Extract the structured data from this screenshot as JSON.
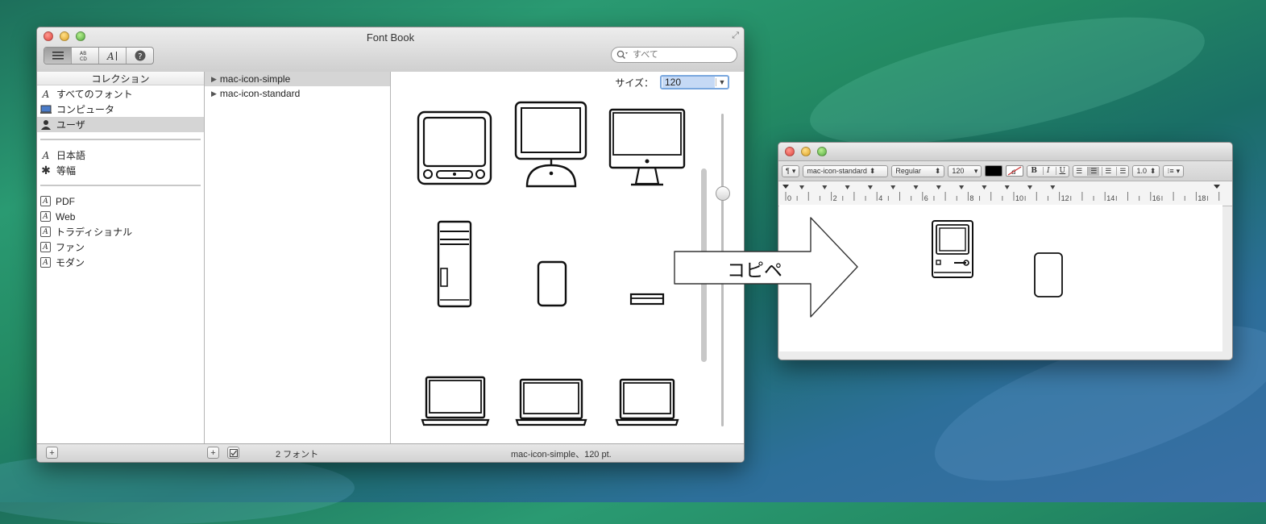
{
  "fontbook": {
    "title": "Font Book",
    "toolbar": {
      "view_buttons": [
        "list-view",
        "sample-view",
        "repertoire-view",
        "info-view"
      ],
      "search_placeholder": "すべて"
    },
    "collections": {
      "header": "コレクション",
      "group1": [
        {
          "label": "すべてのフォント",
          "icon": "font-icon"
        },
        {
          "label": "コンピュータ",
          "icon": "computer-icon"
        },
        {
          "label": "ユーザ",
          "icon": "user-icon",
          "selected": true
        }
      ],
      "group2": [
        {
          "label": "日本語",
          "icon": "font-icon"
        },
        {
          "label": "等幅",
          "icon": "gear-icon"
        }
      ],
      "group3": [
        {
          "label": "PDF",
          "icon": "collection-icon"
        },
        {
          "label": "Web",
          "icon": "collection-icon"
        },
        {
          "label": "トラディショナル",
          "icon": "collection-icon"
        },
        {
          "label": "ファン",
          "icon": "collection-icon"
        },
        {
          "label": "モダン",
          "icon": "collection-icon"
        }
      ]
    },
    "families": [
      {
        "label": "mac-icon-simple",
        "selected": true
      },
      {
        "label": "mac-icon-standard",
        "selected": false
      }
    ],
    "preview": {
      "size_label": "サイズ：",
      "size_value": "120"
    },
    "status": {
      "font_count": "2 フォント",
      "selection_info": "mac-icon-simple、120 pt."
    }
  },
  "overlay": {
    "arrow_label": "コピペ"
  },
  "textedit": {
    "toolbar": {
      "paragraph": "¶",
      "font_family": "mac-icon-standard",
      "font_style": "Regular",
      "font_size": "120",
      "bold": "B",
      "italic": "I",
      "underline": "U",
      "line_spacing": "1.0"
    },
    "ruler_labels": [
      "0",
      "2",
      "4",
      "6",
      "8",
      "10",
      "12",
      "14",
      "16",
      "18"
    ],
    "accent_color": "#000000"
  }
}
